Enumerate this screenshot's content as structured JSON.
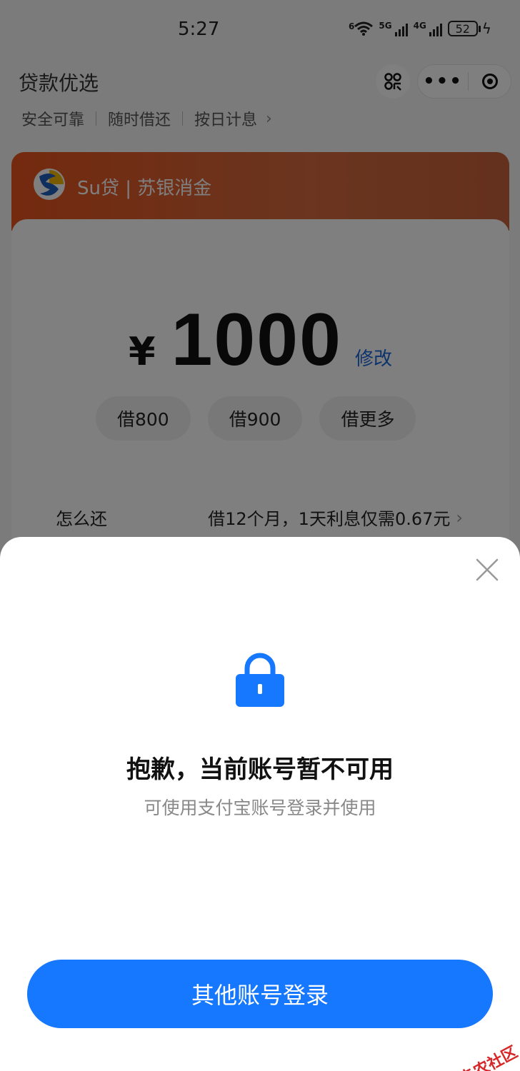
{
  "status_bar": {
    "time": "5:27",
    "wifi_tag": "6",
    "sim1_tag": "5G",
    "sim2_tag": "4G",
    "battery": "52"
  },
  "header": {
    "title": "贷款优选",
    "features": [
      "安全可靠",
      "随时借还",
      "按日计息"
    ]
  },
  "product": {
    "brand": "Su贷 | 苏银消金",
    "currency": "¥",
    "amount": "1000",
    "edit_label": "修改",
    "chips": [
      "借800",
      "借900",
      "借更多"
    ],
    "repay_label": "怎么还",
    "repay_info": "借12个月，1天利息仅需0.67元"
  },
  "dialog": {
    "title": "抱歉，当前账号暂不可用",
    "subtitle": "可使用支付宝账号登录并使用",
    "button_label": "其他账号登录"
  },
  "watermark": {
    "text": "卡农社区"
  },
  "colors": {
    "accent": "#1677ff",
    "brand_header": "#e8541e",
    "link": "#1a66d9",
    "watermark": "#d62828"
  }
}
